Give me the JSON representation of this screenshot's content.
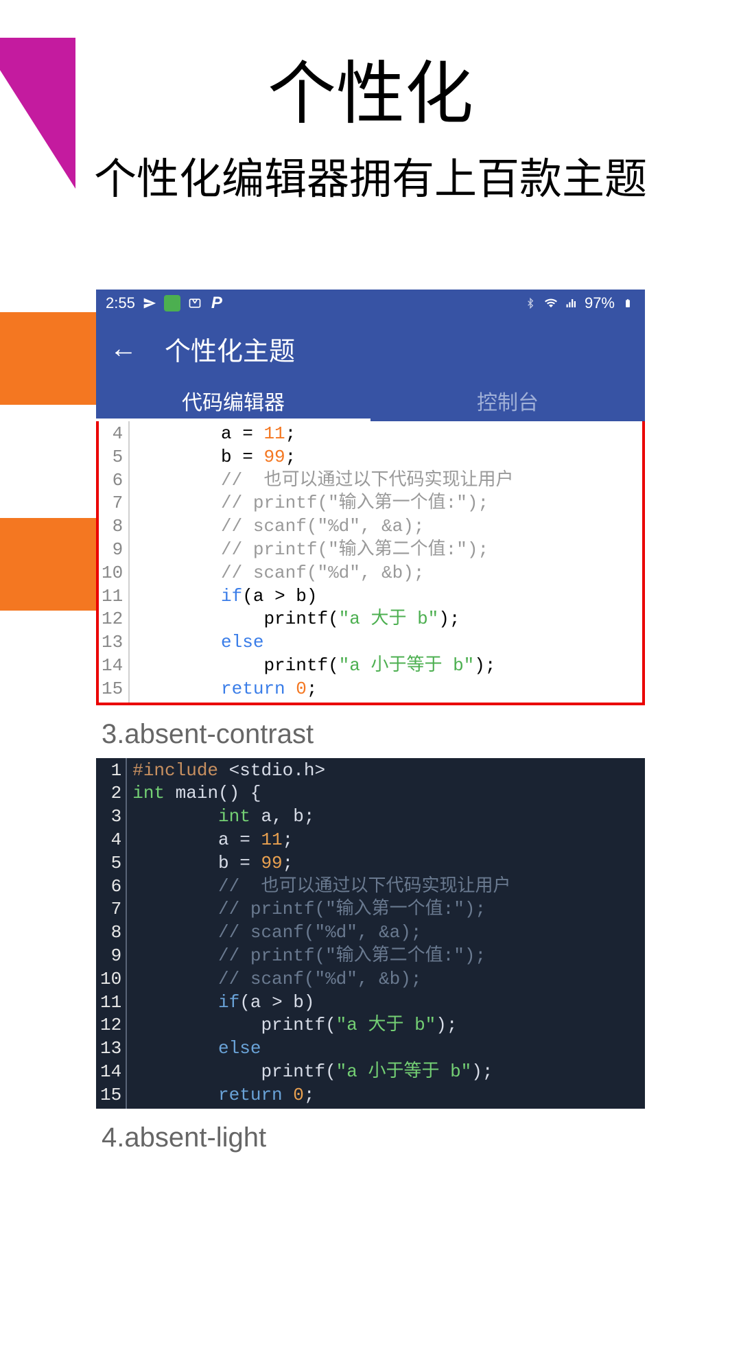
{
  "page": {
    "title": "个性化",
    "subtitle": "个性化编辑器拥有上百款主题"
  },
  "statusBar": {
    "time": "2:55",
    "battery": "97%"
  },
  "appBar": {
    "title": "个性化主题"
  },
  "tabs": {
    "tab1": "代码编辑器",
    "tab2": "控制台"
  },
  "themeLabels": {
    "theme3": "3.absent-contrast",
    "theme4": "4.absent-light"
  },
  "codeLight": {
    "lines": [
      "4",
      "5",
      "6",
      "7",
      "8",
      "9",
      "10",
      "11",
      "12",
      "13",
      "14",
      "15"
    ],
    "line4": {
      "pre": "        a = ",
      "val": "11",
      "post": ";"
    },
    "line5": {
      "pre": "        b = ",
      "val": "99",
      "post": ";"
    },
    "line6": "        //  也可以通过以下代码实现让用户",
    "line7": "        // printf(\"输入第一个值:\");",
    "line8": "        // scanf(\"%d\", &a);",
    "line9": "        // printf(\"输入第二个值:\");",
    "line10": "        // scanf(\"%d\", &b);",
    "line11": {
      "kw": "if",
      "rest": "(a > b)"
    },
    "line12": {
      "fn": "            printf(",
      "str": "\"a 大于 b\"",
      "end": ");"
    },
    "line13": {
      "kw": "else"
    },
    "line14": {
      "fn": "            printf(",
      "str": "\"a 小于等于 b\"",
      "end": ");"
    },
    "line15": {
      "kw": "return",
      "sp": " ",
      "val": "0",
      "end": ";"
    }
  },
  "codeDark": {
    "lines": [
      "1",
      "2",
      "3",
      "4",
      "5",
      "6",
      "7",
      "8",
      "9",
      "10",
      "11",
      "12",
      "13",
      "14",
      "15"
    ],
    "line1": {
      "inc": "#include",
      "rest": " <stdio.h>"
    },
    "line2": {
      "type": "int",
      "fn": " main() {"
    },
    "line3": {
      "pre": "        ",
      "type": "int",
      "rest": " a, b;"
    },
    "line4": {
      "pre": "        a = ",
      "val": "11",
      "post": ";"
    },
    "line5": {
      "pre": "        b = ",
      "val": "99",
      "post": ";"
    },
    "line6": "        //  也可以通过以下代码实现让用户",
    "line7": "        // printf(\"输入第一个值:\");",
    "line8": "        // scanf(\"%d\", &a);",
    "line9": "        // printf(\"输入第二个值:\");",
    "line10": "        // scanf(\"%d\", &b);",
    "line11": {
      "kw": "if",
      "rest": "(a > b)"
    },
    "line12": {
      "fn": "            printf(",
      "str": "\"a 大于 b\"",
      "end": ");"
    },
    "line13": {
      "kw": "else"
    },
    "line14": {
      "fn": "            printf(",
      "str": "\"a 小于等于 b\"",
      "end": ");"
    },
    "line15": {
      "kw": "return",
      "sp": " ",
      "val": "0",
      "end": ";"
    }
  }
}
